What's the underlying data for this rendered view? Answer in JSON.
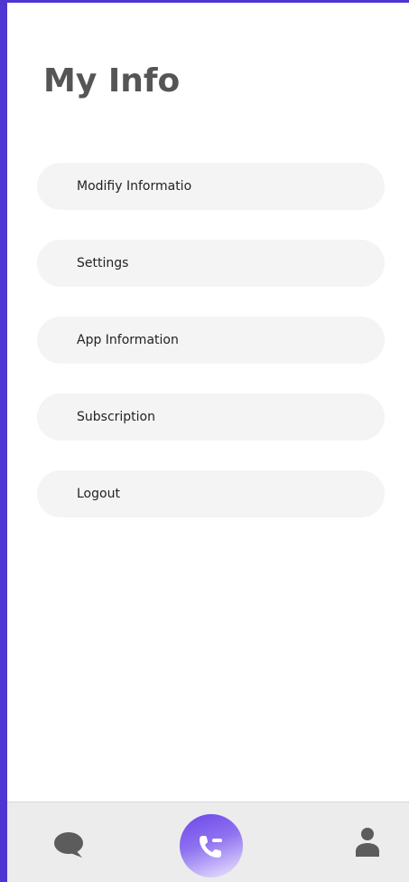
{
  "page": {
    "title": "My Info"
  },
  "menu": {
    "items": [
      {
        "label": "Modifiy Informatio"
      },
      {
        "label": "Settings"
      },
      {
        "label": "App Information"
      },
      {
        "label": "Subscription"
      },
      {
        "label": "Logout"
      }
    ]
  },
  "tabbar": {
    "tabs": [
      {
        "icon": "chat-bubble-icon"
      },
      {
        "icon": "phone-call-icon",
        "active": true
      },
      {
        "icon": "user-profile-icon"
      }
    ]
  },
  "colors": {
    "accent": "#4f35d1",
    "menu_item_bg": "#f4f4f4",
    "tabbar_bg": "#ececec",
    "title": "#555555"
  }
}
